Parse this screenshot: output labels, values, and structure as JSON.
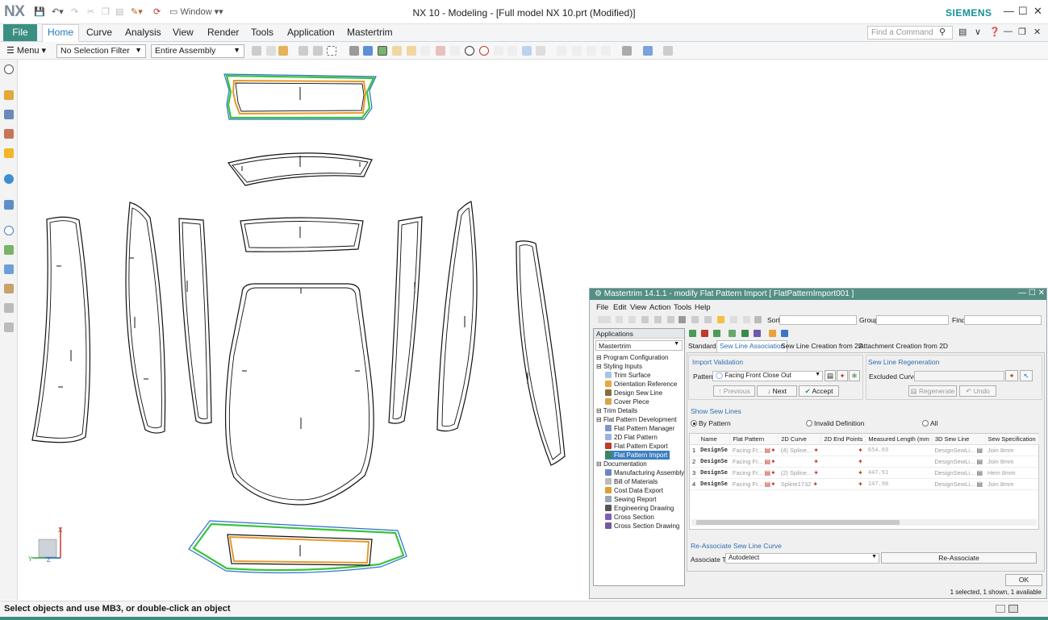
{
  "titlebar": {
    "logo": "NX",
    "window_menu": "Window",
    "title": "NX 10 - Modeling - [Full model NX 10.prt (Modified)]",
    "brand": "SIEMENS"
  },
  "ribbon": {
    "file": "File",
    "tabs": [
      "Home",
      "Curve",
      "Analysis",
      "View",
      "Render",
      "Tools",
      "Application",
      "Mastertrim"
    ],
    "active_tab": "Home",
    "find_placeholder": "Find a Command"
  },
  "toolbar": {
    "menu": "Menu",
    "selection_filter": "No Selection Filter",
    "scope": "Entire Assembly"
  },
  "statusbar": {
    "message": "Select objects and use MB3, or double-click an object"
  },
  "colors": {
    "accent": "#3b8f82",
    "brand": "#15909b",
    "curve_orange": "#e59a2b",
    "curve_green": "#39c43a",
    "curve_blue": "#2f6fd1"
  },
  "dialog": {
    "title": "Mastertrim 14.1.1 - modify Flat Pattern Import [ FlatPatternImport001 ]",
    "menus": [
      "File",
      "Edit",
      "View",
      "Action",
      "Tools",
      "Help"
    ],
    "sort_label": "Sort",
    "group_label": "Group",
    "find_label": "Find",
    "applications_header": "Applications",
    "app_select": "Mastertrim",
    "tree": [
      {
        "label": "Program Configuration",
        "level": 0,
        "icon": "expand"
      },
      {
        "label": "Styling Inputs",
        "level": 0,
        "icon": "collapse"
      },
      {
        "label": "Trim Surface",
        "level": 1,
        "icon": "surface"
      },
      {
        "label": "Orientation Reference",
        "level": 1,
        "icon": "reference"
      },
      {
        "label": "Design Sew Line",
        "level": 1,
        "icon": "pen"
      },
      {
        "label": "Cover Piece",
        "level": 1,
        "icon": "cover"
      },
      {
        "label": "Trim Details",
        "level": 0,
        "icon": "expand"
      },
      {
        "label": "Flat Pattern Development",
        "level": 0,
        "icon": "collapse"
      },
      {
        "label": "Flat Pattern Manager",
        "level": 1,
        "icon": "manager"
      },
      {
        "label": "2D Flat Pattern",
        "level": 1,
        "icon": "pattern"
      },
      {
        "label": "Flat Pattern Export",
        "level": 1,
        "icon": "export"
      },
      {
        "label": "Flat Pattern Import",
        "level": 1,
        "icon": "import"
      },
      {
        "label": "Documentation",
        "level": 0,
        "icon": "collapse"
      },
      {
        "label": "Manufacturing Assembly",
        "level": 1,
        "icon": "assembly"
      },
      {
        "label": "Bill of Materials",
        "level": 1,
        "icon": "bom"
      },
      {
        "label": "Cost Data Export",
        "level": 1,
        "icon": "cost"
      },
      {
        "label": "Sewing Report",
        "level": 1,
        "icon": "report"
      },
      {
        "label": "Engineering Drawing",
        "level": 1,
        "icon": "drawing"
      },
      {
        "label": "Cross Section",
        "level": 1,
        "icon": "section"
      },
      {
        "label": "Cross Section Drawing",
        "level": 1,
        "icon": "section-drawing"
      }
    ],
    "selected_tree_item": "Flat Pattern Import",
    "tabs": [
      "Standard",
      "Sew Line Association",
      "Sew Line Creation from 2D",
      "Attachment Creation from 2D"
    ],
    "active_tab": "Sew Line Association",
    "import_validation": {
      "title": "Import Validation",
      "pattern_label": "Pattern",
      "pattern_value": "Facing Front Close Out",
      "previous": "Previous",
      "next": "Next",
      "accept": "Accept"
    },
    "regeneration": {
      "title": "Sew Line Regeneration",
      "excluded_label": "Excluded Curves",
      "regenerate": "Regenerate",
      "undo": "Undo"
    },
    "show_sew_lines": {
      "title": "Show Sew Lines",
      "options": [
        "By Pattern",
        "Invalid Definition",
        "All"
      ],
      "selected": "By Pattern"
    },
    "grid": {
      "columns": [
        "",
        "Name",
        "Flat Pattern",
        "2D Curve",
        "2D End Points",
        "Measured Length (mm",
        "3D Sew Line",
        "Sew Specification"
      ],
      "rows": [
        {
          "num": "1",
          "name": "DesignSe",
          "flat": "Facing Fr...",
          "curve": "(4) Spline...",
          "ends": "",
          "length": "654.69",
          "sew": "DesignSewLi...",
          "spec": "Join 8mm"
        },
        {
          "num": "2",
          "name": "DesignSe",
          "flat": "Facing Fr...",
          "curve": "",
          "ends": "",
          "length": "",
          "sew": "DesignSewLi...",
          "spec": "Join 8mm"
        },
        {
          "num": "3",
          "name": "DesignSe",
          "flat": "Facing Fr...",
          "curve": "(2) Spline...",
          "ends": "",
          "length": "447.91",
          "sew": "DesignSewLi...",
          "spec": "Hem 8mm"
        },
        {
          "num": "4",
          "name": "DesignSe",
          "flat": "Facing Fr...",
          "curve": "Spline1732",
          "ends": "",
          "length": "147.98",
          "sew": "DesignSewLi...",
          "spec": "Join 8mm"
        }
      ]
    },
    "reassociate": {
      "title": "Re-Associate Sew Line Curve",
      "associate_label": "Associate To",
      "associate_value": "Autodetect",
      "button": "Re-Associate"
    },
    "ok": "OK",
    "footer_info": "1 selected, 1 shown, 1 available"
  }
}
